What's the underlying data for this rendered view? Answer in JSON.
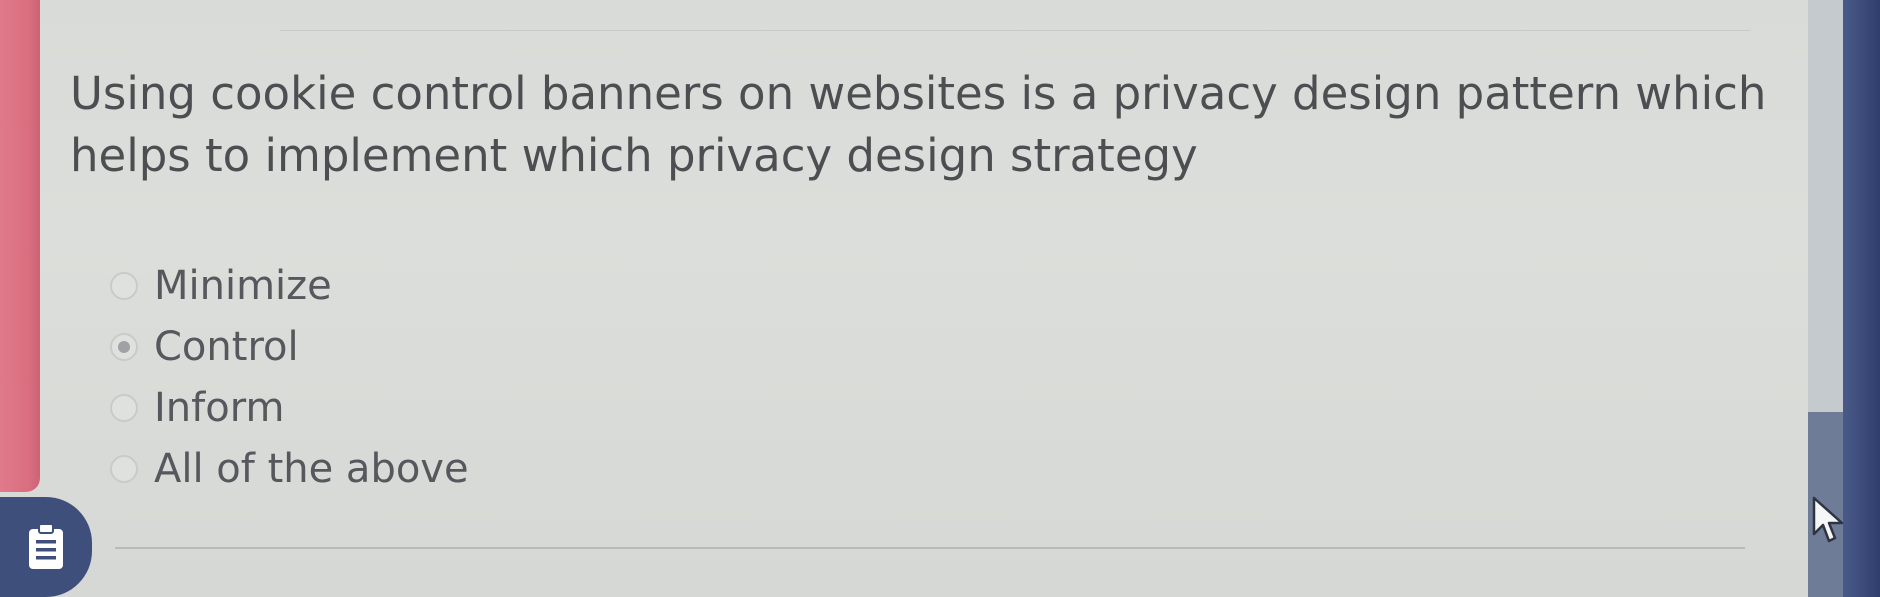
{
  "question": {
    "text": "Using cookie control banners on websites is a privacy design pattern which helps to implement which privacy design strategy"
  },
  "options": [
    {
      "label": "Minimize",
      "selected": false
    },
    {
      "label": "Control",
      "selected": true
    },
    {
      "label": "Inform",
      "selected": false
    },
    {
      "label": "All of the above",
      "selected": false
    }
  ],
  "icons": {
    "notes_button": "clipboard-icon",
    "cursor": "mouse-pointer-icon"
  },
  "colors": {
    "accent": "#d96f80",
    "notes_button": "#3f4f7c",
    "text": "#4c4e52"
  }
}
